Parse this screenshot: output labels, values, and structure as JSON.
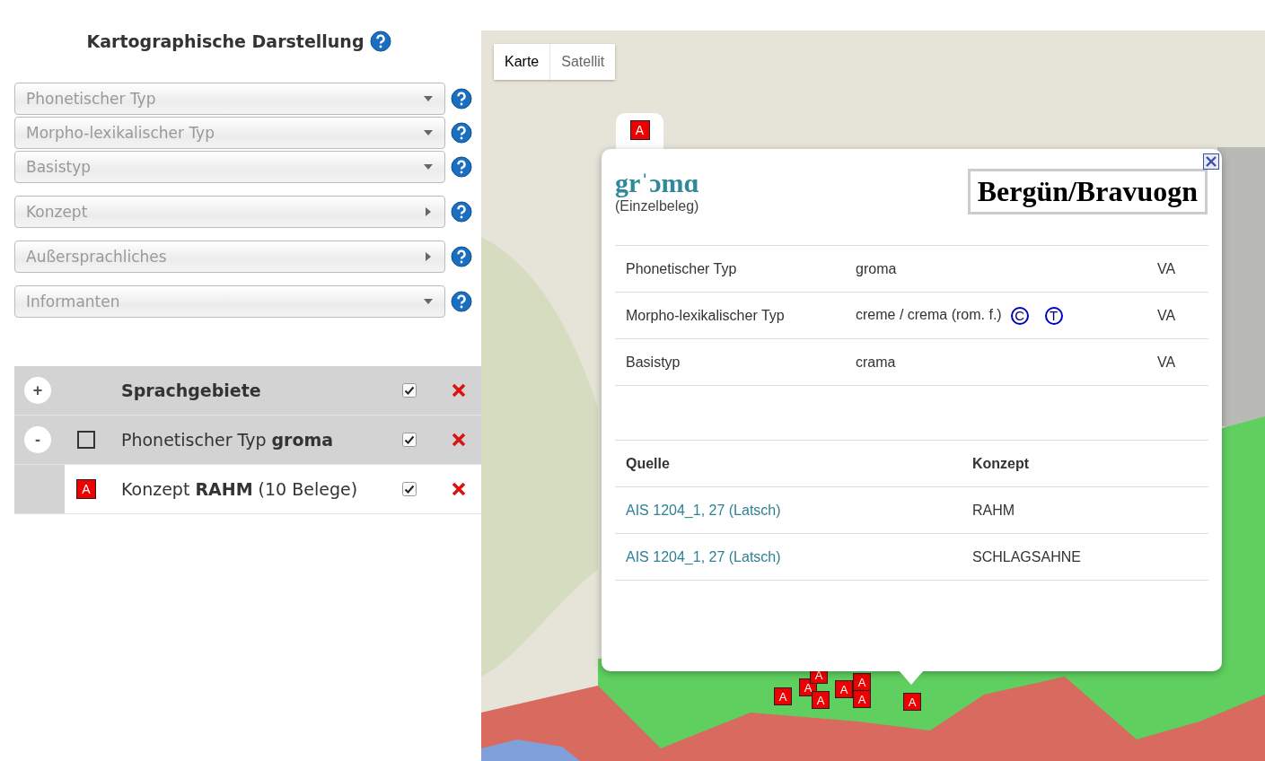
{
  "panel": {
    "title": "Kartographische Darstellung",
    "filters": [
      {
        "label": "Phonetischer Typ",
        "kind": "dropdown"
      },
      {
        "label": "Morpho-lexikalischer Typ",
        "kind": "dropdown"
      },
      {
        "label": "Basistyp",
        "kind": "dropdown"
      },
      {
        "label": "Konzept",
        "kind": "submenu"
      },
      {
        "label": "Außersprachliches",
        "kind": "submenu"
      },
      {
        "label": "Informanten",
        "kind": "dropdown"
      }
    ]
  },
  "layers": [
    {
      "kind": "group",
      "toggle": "+",
      "label": "Sprachgebiete",
      "visible": true
    },
    {
      "kind": "type",
      "toggle": "-",
      "label": "Phonetischer Typ **groma**",
      "visible": true
    },
    {
      "kind": "concept",
      "symbol": "A",
      "label": "Konzept **RAHM** (10 Belege)",
      "visible": true
    }
  ],
  "map": {
    "map_types": [
      {
        "label": "Karte",
        "selected": true
      },
      {
        "label": "Satellit",
        "selected": false
      }
    ],
    "markers": [
      {
        "symbol": "A"
      },
      {
        "symbol": "A"
      },
      {
        "symbol": "A"
      },
      {
        "symbol": "A"
      },
      {
        "symbol": "A"
      },
      {
        "symbol": "A"
      },
      {
        "symbol": "A"
      },
      {
        "symbol": "A"
      }
    ]
  },
  "popup": {
    "tab_symbol": "A",
    "title": "grˈɔmɑ",
    "subtitle": "(Einzelbeleg)",
    "place": "Bergün/Bravuogn",
    "types": [
      {
        "label": "Phonetischer Typ",
        "value": "groma",
        "source": "VA"
      },
      {
        "label": "Morpho-lexikalischer Typ",
        "value": "creme / crema (rom. f.)",
        "badges": [
          "C",
          "T"
        ],
        "source": "VA"
      },
      {
        "label": "Basistyp",
        "value": "crama",
        "source": "VA"
      }
    ],
    "source_columns": [
      "Quelle",
      "Konzept"
    ],
    "sources": [
      {
        "source": "AIS 1204_1, 27 (Latsch)",
        "concept": "RAHM"
      },
      {
        "source": "AIS 1204_1, 27 (Latsch)",
        "concept": "SCHLAGSAHNE"
      }
    ]
  }
}
